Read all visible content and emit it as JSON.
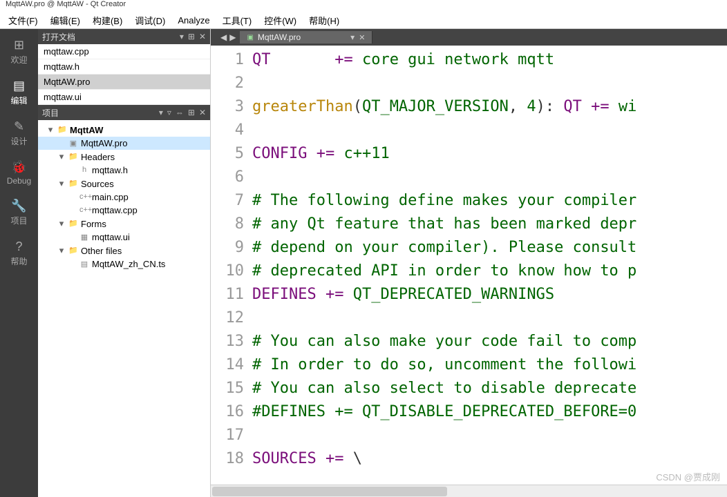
{
  "title": "MqttAW.pro @ MqttAW - Qt Creator",
  "menubar": [
    "文件(F)",
    "编辑(E)",
    "构建(B)",
    "调试(D)",
    "Analyze",
    "工具(T)",
    "控件(W)",
    "帮助(H)"
  ],
  "leftbar": [
    {
      "label": "欢迎",
      "icon": "⊞"
    },
    {
      "label": "编辑",
      "icon": "▤",
      "active": true
    },
    {
      "label": "设计",
      "icon": "✎"
    },
    {
      "label": "Debug",
      "icon": "🐞"
    },
    {
      "label": "项目",
      "icon": "🔧"
    },
    {
      "label": "帮助",
      "icon": "?"
    }
  ],
  "panels": {
    "open_docs": {
      "title": "打开文档",
      "items": [
        "mqttaw.cpp",
        "mqttaw.h",
        "MqttAW.pro",
        "mqttaw.ui"
      ],
      "selected": 2
    },
    "project": {
      "title": "项目",
      "tree": [
        {
          "depth": 1,
          "label": "MqttAW",
          "chev": "▾",
          "icon": "folder",
          "bold": true
        },
        {
          "depth": 2,
          "label": "MqttAW.pro",
          "icon": "pro",
          "sel": true
        },
        {
          "depth": 2,
          "label": "Headers",
          "chev": "▾",
          "icon": "folder"
        },
        {
          "depth": 3,
          "label": "mqttaw.h",
          "icon": "h"
        },
        {
          "depth": 2,
          "label": "Sources",
          "chev": "▾",
          "icon": "folder"
        },
        {
          "depth": 3,
          "label": "main.cpp",
          "icon": "cpp"
        },
        {
          "depth": 3,
          "label": "mqttaw.cpp",
          "icon": "cpp"
        },
        {
          "depth": 2,
          "label": "Forms",
          "chev": "▾",
          "icon": "folder"
        },
        {
          "depth": 3,
          "label": "mqttaw.ui",
          "icon": "ui"
        },
        {
          "depth": 2,
          "label": "Other files",
          "chev": "▾",
          "icon": "folder"
        },
        {
          "depth": 3,
          "label": "MqttAW_zh_CN.ts",
          "icon": "ts"
        }
      ]
    }
  },
  "tab": {
    "label": "MqttAW.pro"
  },
  "code_lines": [
    {
      "n": 1,
      "tokens": [
        {
          "t": "QT",
          "c": "kw"
        },
        {
          "t": "       += ",
          "c": "kw"
        },
        {
          "t": "core gui network mqtt",
          "c": "id"
        }
      ]
    },
    {
      "n": 2,
      "tokens": []
    },
    {
      "n": 3,
      "tokens": [
        {
          "t": "greaterThan",
          "c": "fn"
        },
        {
          "t": "(",
          "c": "txt"
        },
        {
          "t": "QT_MAJOR_VERSION",
          "c": "id"
        },
        {
          "t": ", ",
          "c": "txt"
        },
        {
          "t": "4",
          "c": "num"
        },
        {
          "t": "): ",
          "c": "txt"
        },
        {
          "t": "QT",
          "c": "kw"
        },
        {
          "t": " += ",
          "c": "kw"
        },
        {
          "t": "wi",
          "c": "id"
        }
      ]
    },
    {
      "n": 4,
      "tokens": []
    },
    {
      "n": 5,
      "tokens": [
        {
          "t": "CONFIG",
          "c": "kw"
        },
        {
          "t": " += ",
          "c": "kw"
        },
        {
          "t": "c++11",
          "c": "id"
        }
      ]
    },
    {
      "n": 6,
      "tokens": []
    },
    {
      "n": 7,
      "tokens": [
        {
          "t": "# The following define makes your compiler",
          "c": "com"
        }
      ]
    },
    {
      "n": 8,
      "tokens": [
        {
          "t": "# any Qt feature that has been marked depr",
          "c": "com"
        }
      ]
    },
    {
      "n": 9,
      "tokens": [
        {
          "t": "# depend on your compiler). Please consult",
          "c": "com"
        }
      ]
    },
    {
      "n": 10,
      "tokens": [
        {
          "t": "# deprecated API in order to know how to p",
          "c": "com"
        }
      ]
    },
    {
      "n": 11,
      "tokens": [
        {
          "t": "DEFINES",
          "c": "kw"
        },
        {
          "t": " += ",
          "c": "kw"
        },
        {
          "t": "QT_DEPRECATED_WARNINGS",
          "c": "id"
        }
      ]
    },
    {
      "n": 12,
      "tokens": []
    },
    {
      "n": 13,
      "tokens": [
        {
          "t": "# You can also make your code fail to comp",
          "c": "com"
        }
      ]
    },
    {
      "n": 14,
      "tokens": [
        {
          "t": "# In order to do so, uncomment the followi",
          "c": "com"
        }
      ]
    },
    {
      "n": 15,
      "tokens": [
        {
          "t": "# You can also select to disable deprecate",
          "c": "com"
        }
      ]
    },
    {
      "n": 16,
      "tokens": [
        {
          "t": "#DEFINES += QT_DISABLE_DEPRECATED_BEFORE=0",
          "c": "com"
        }
      ]
    },
    {
      "n": 17,
      "tokens": []
    },
    {
      "n": 18,
      "tokens": [
        {
          "t": "SOURCES",
          "c": "kw"
        },
        {
          "t": " += ",
          "c": "kw"
        },
        {
          "t": "\\",
          "c": "txt"
        }
      ]
    }
  ],
  "watermark": "CSDN @贾成刚"
}
